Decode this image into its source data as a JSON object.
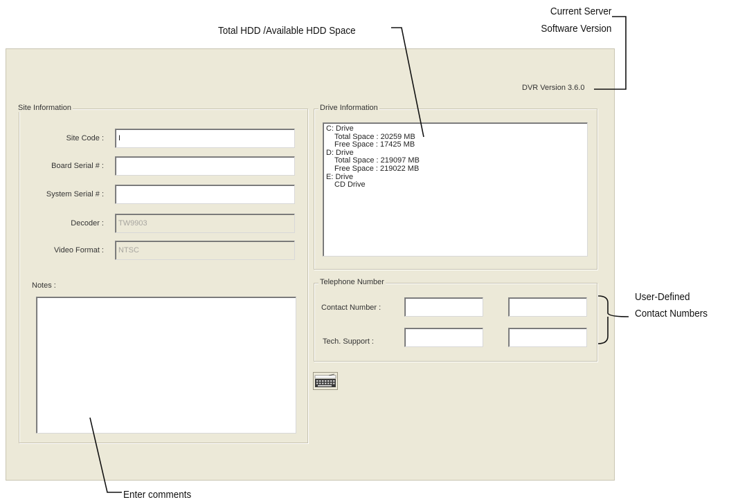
{
  "annotations": {
    "hdd_space": "Total HDD /Available HDD Space",
    "server_version_line1": "Current Server",
    "server_version_line2": "Software Version",
    "contact_numbers_line1": "User-Defined",
    "contact_numbers_line2": "Contact Numbers",
    "comments": "Enter comments"
  },
  "dvr_version": "DVR Version 3.6.0",
  "site_info": {
    "legend": "Site Information",
    "site_code_label": "Site Code :",
    "site_code_value": "I",
    "board_serial_label": "Board Serial # :",
    "board_serial_value": "",
    "system_serial_label": "System Serial # :",
    "system_serial_value": "",
    "decoder_label": "Decoder :",
    "decoder_value": "TW9903",
    "video_format_label": "Video Format :",
    "video_format_value": "NTSC",
    "notes_label": "Notes :",
    "notes_value": ""
  },
  "drive_info": {
    "legend": "Drive Information",
    "drives": [
      {
        "name": "C: Drive",
        "details": [
          "Total Space : 20259 MB",
          "Free Space : 17425 MB"
        ]
      },
      {
        "name": "D: Drive",
        "details": [
          "Total Space : 219097 MB",
          "Free Space : 219022 MB"
        ]
      },
      {
        "name": "E: Drive",
        "details": [
          "CD Drive"
        ]
      }
    ]
  },
  "telephone": {
    "legend": "Telephone Number",
    "contact_label": "Contact Number :",
    "tech_support_label": "Tech. Support :",
    "contact_value_1": "",
    "contact_value_2": "",
    "tech_value_1": "",
    "tech_value_2": ""
  },
  "icons": {
    "keyboard_button": "keyboard-icon"
  }
}
